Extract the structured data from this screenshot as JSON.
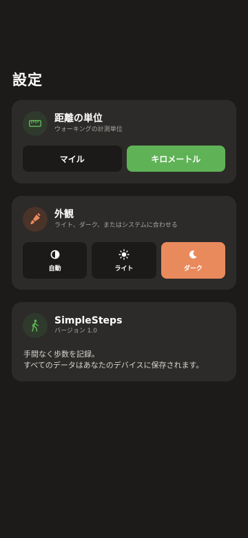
{
  "page": {
    "title": "設定"
  },
  "distance_unit": {
    "title": "距離の単位",
    "subtitle": "ウォーキングの計測単位",
    "options": [
      "マイル",
      "キロメートル"
    ],
    "selected": "キロメートル",
    "icon": "ruler-icon"
  },
  "appearance": {
    "title": "外観",
    "subtitle": "ライト、ダーク、またはシステムに合わせる",
    "icon": "paintbrush-icon",
    "options": [
      {
        "label": "自動",
        "icon": "circle-half-icon"
      },
      {
        "label": "ライト",
        "icon": "sun-icon"
      },
      {
        "label": "ダーク",
        "icon": "moon-icon"
      }
    ],
    "selected": "ダーク"
  },
  "about": {
    "app_name": "SimpleSteps",
    "version": "バージョン 1.0",
    "icon": "walking-figure-icon",
    "description_line1": "手間なく歩数を記録。",
    "description_line2": "すべてのデータはあなたのデバイスに保存されます。"
  },
  "colors": {
    "background": "#1c1b1a",
    "card": "#2c2b29",
    "accent_green": "#5fb356",
    "accent_orange": "#e98a5d"
  }
}
